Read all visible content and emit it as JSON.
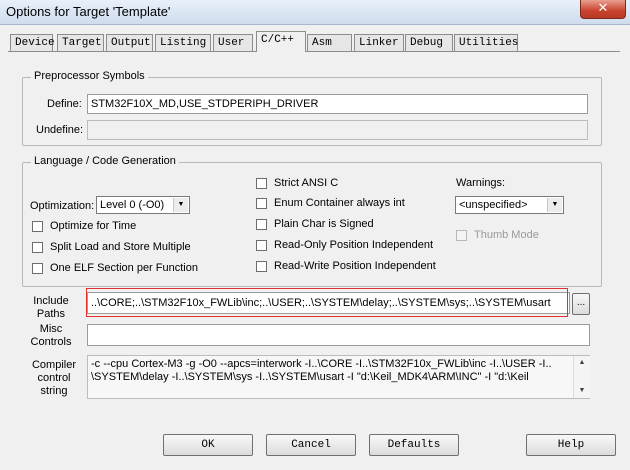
{
  "window": {
    "title": "Options for Target 'Template'",
    "close_glyph": "✕"
  },
  "tabs": [
    {
      "label": "Device"
    },
    {
      "label": "Target"
    },
    {
      "label": "Output"
    },
    {
      "label": "Listing"
    },
    {
      "label": "User"
    },
    {
      "label": "C/C++",
      "active": true
    },
    {
      "label": "Asm"
    },
    {
      "label": "Linker"
    },
    {
      "label": "Debug"
    },
    {
      "label": "Utilities"
    }
  ],
  "preprocessor": {
    "title": "Preprocessor Symbols",
    "define_label": "Define:",
    "define_value": "STM32F10X_MD,USE_STDPERIPH_DRIVER",
    "undefine_label": "Undefine:",
    "undefine_value": ""
  },
  "language": {
    "title": "Language / Code Generation",
    "optimization_label": "Optimization:",
    "optimization_value": "Level 0 (-O0)",
    "left_checks": [
      {
        "label": "Optimize for Time",
        "checked": false
      },
      {
        "label": "Split Load and Store Multiple",
        "checked": false
      },
      {
        "label": "One ELF Section per Function",
        "checked": false
      }
    ],
    "mid_checks": [
      {
        "label": "Strict ANSI C",
        "checked": false
      },
      {
        "label": "Enum Container always int",
        "checked": false
      },
      {
        "label": "Plain Char is Signed",
        "checked": false
      },
      {
        "label": "Read-Only Position Independent",
        "checked": false
      },
      {
        "label": "Read-Write Position Independent",
        "checked": false
      }
    ],
    "warnings_label": "Warnings:",
    "warnings_value": "<unspecified>",
    "thumb_mode_label": "Thumb Mode"
  },
  "include_paths": {
    "label": "Include\nPaths",
    "value": "..\\CORE;..\\STM32F10x_FWLib\\inc;..\\USER;..\\SYSTEM\\delay;..\\SYSTEM\\sys;..\\SYSTEM\\usart",
    "browse_label": "..."
  },
  "misc_controls": {
    "label": "Misc\nControls",
    "value": ""
  },
  "compiler_string": {
    "label": "Compiler\ncontrol\nstring",
    "line1": "-c --cpu Cortex-M3 -g -O0 --apcs=interwork -I..\\CORE -I..\\STM32F10x_FWLib\\inc -I..\\USER -I..",
    "line2": "\\SYSTEM\\delay -I..\\SYSTEM\\sys -I..\\SYSTEM\\usart -I \"d:\\Keil_MDK4\\ARM\\INC\" -I \"d:\\Keil"
  },
  "buttons": {
    "ok": "OK",
    "cancel": "Cancel",
    "defaults": "Defaults",
    "help": "Help"
  },
  "colors": {
    "highlight": "#e03030"
  }
}
